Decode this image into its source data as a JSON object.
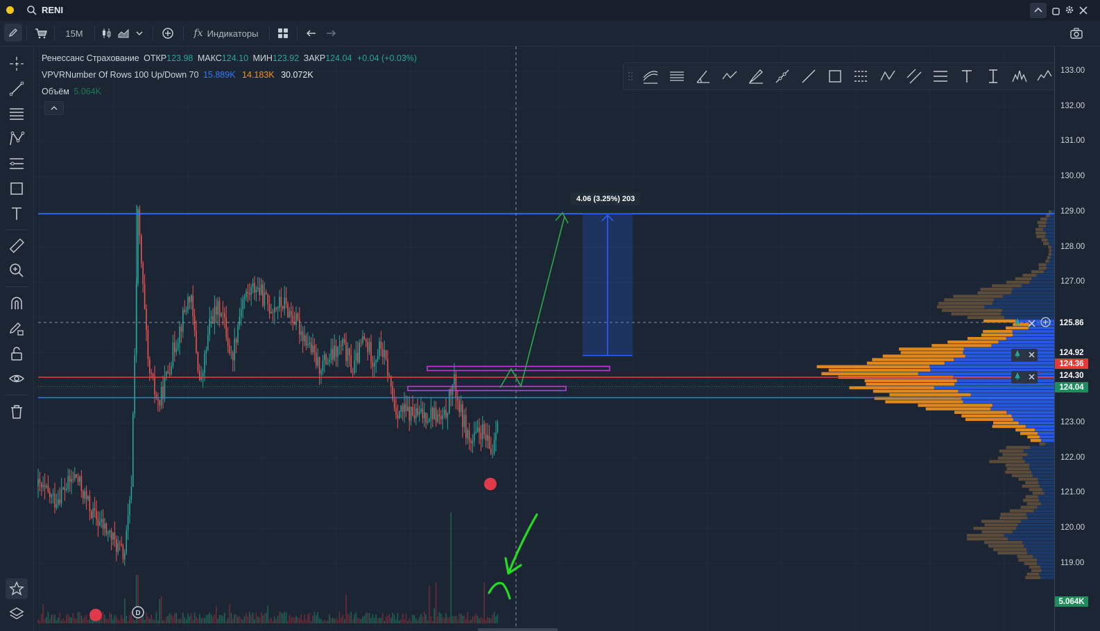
{
  "window": {
    "symbol": "RENI",
    "status_color": "#f5c518"
  },
  "toolbar": {
    "interval": "15M",
    "indicators_label": "Индикаторы"
  },
  "legend": {
    "company": "Ренессанс Страхование",
    "open_label": "ОТКР",
    "open_value": "123.98",
    "high_label": "МАКС",
    "high_value": "124.10",
    "low_label": "МИН",
    "low_value": "123.92",
    "close_label": "ЗАКР",
    "close_value": "124.04",
    "change": "+0.04 (+0.03%)",
    "vpvr_name": "VPVRNumber Of Rows 100 Up/Down 70",
    "vpvr_up": "15.889K",
    "vpvr_down": "14.183K",
    "vpvr_total": "30.072K",
    "volume_label": "Объём",
    "volume_value": "5.064K"
  },
  "measure": {
    "label": "4.06 (3.25%) 203"
  },
  "price_axis": {
    "ticks": [
      "133.00",
      "132.00",
      "131.00",
      "130.00",
      "129.00",
      "128.00",
      "127.00",
      "122.00",
      "121.00",
      "120.00",
      "119.00"
    ],
    "tags": {
      "crosshair": "125.86",
      "alert_high": "124.92",
      "last": "124.36",
      "alert_mid": "124.30",
      "close": "124.04",
      "volume": "5.064K"
    },
    "extra_tick": "123.00"
  },
  "colors": {
    "background": "#1b2533",
    "up": "#26a69a",
    "down": "#ef5350",
    "vpvr_up": "#2962ff",
    "vpvr_down": "#f7931a",
    "level_blue": "#2f7bff",
    "level_red": "#e53935",
    "green_note": "#22dd22"
  }
}
